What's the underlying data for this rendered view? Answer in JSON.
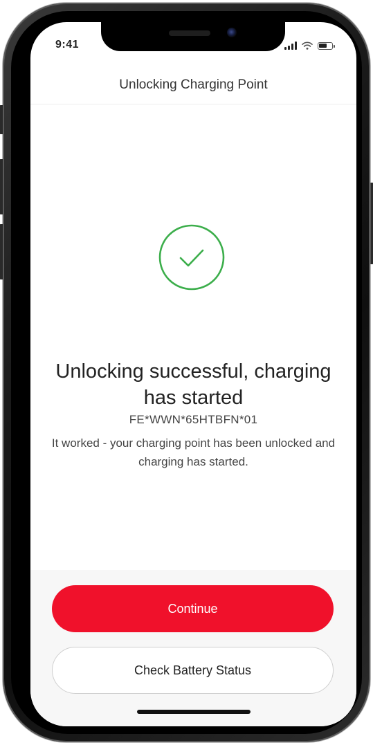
{
  "status_bar": {
    "time": "9:41",
    "icons": [
      "signal-icon",
      "wifi-icon",
      "battery-icon"
    ],
    "battery_level": 0.7
  },
  "header": {
    "title": "Unlocking Charging Point"
  },
  "result": {
    "icon": "check-circle-icon",
    "headline": "Unlocking successful, charging has started",
    "charger_id": "FE*WWN*65HTBFN*01",
    "description": "It worked - your charging point has been unlocked and charging has started."
  },
  "actions": {
    "continue_label": "Continue",
    "battery_status_label": "Check Battery Status"
  },
  "colors": {
    "accent": "#f0112b",
    "success": "#3cae4b",
    "text": "#222222",
    "muted_text": "#444444",
    "footer_bg": "#f7f7f7"
  }
}
